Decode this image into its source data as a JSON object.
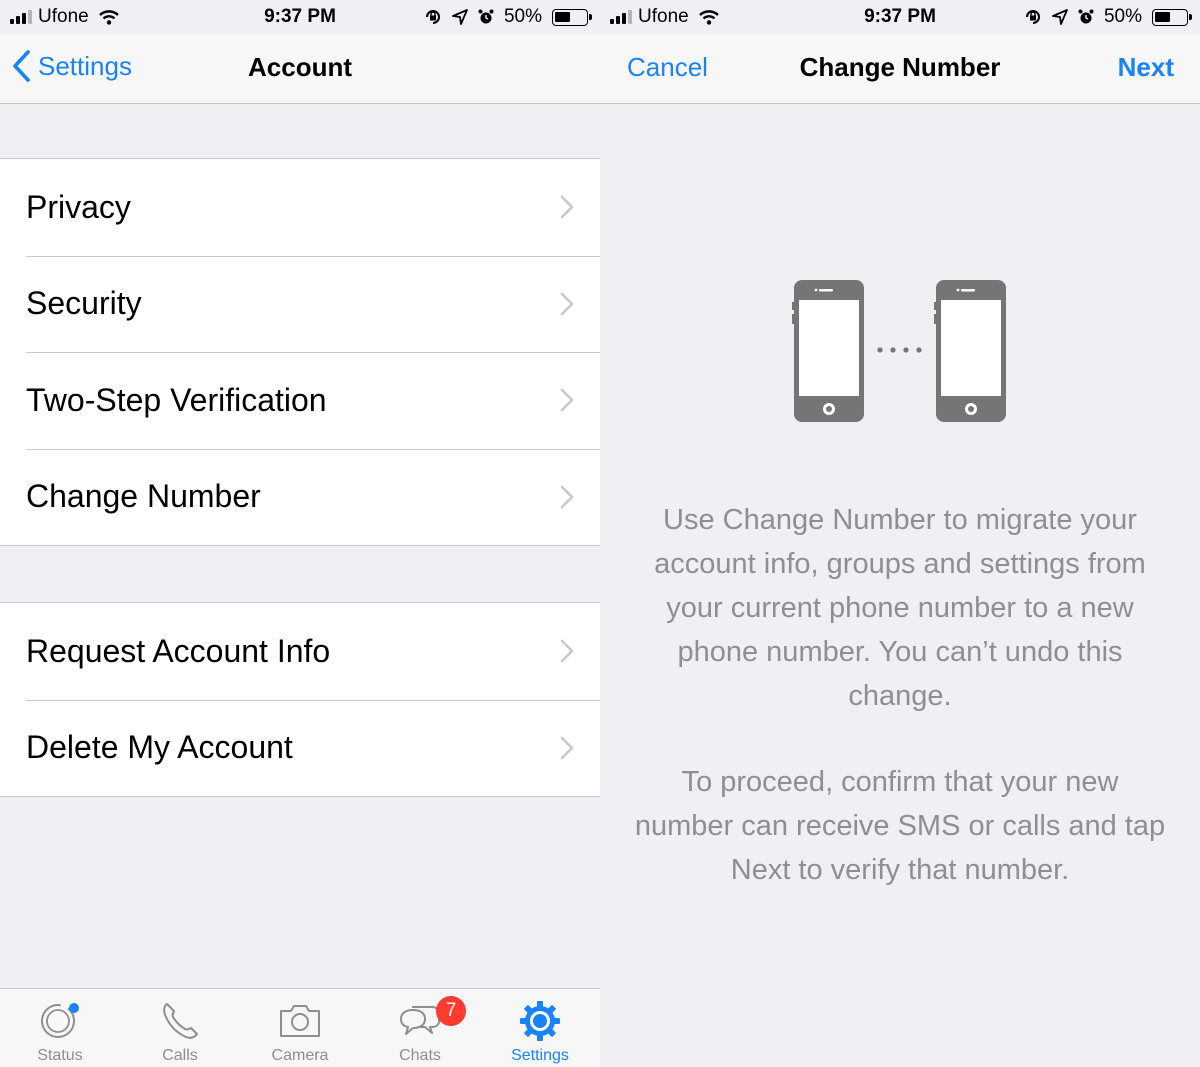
{
  "status_bar": {
    "carrier": "Ufone",
    "time": "9:37 PM",
    "battery": "50%",
    "battery_level": 0.5,
    "icons": [
      "signal-icon",
      "wifi-icon",
      "orientation-lock-icon",
      "location-icon",
      "alarm-icon",
      "battery-icon"
    ]
  },
  "account_screen": {
    "nav": {
      "back_label": "Settings",
      "title": "Account"
    },
    "groups": [
      {
        "items": [
          {
            "label": "Privacy"
          },
          {
            "label": "Security"
          },
          {
            "label": "Two-Step Verification"
          },
          {
            "label": "Change Number"
          }
        ]
      },
      {
        "items": [
          {
            "label": "Request Account Info"
          },
          {
            "label": "Delete My Account"
          }
        ]
      }
    ],
    "tab_bar": {
      "tabs": [
        {
          "label": "Status",
          "icon": "status-icon",
          "has_dot": true
        },
        {
          "label": "Calls",
          "icon": "phone-icon"
        },
        {
          "label": "Camera",
          "icon": "camera-icon"
        },
        {
          "label": "Chats",
          "icon": "chat-bubbles-icon",
          "badge": "7"
        },
        {
          "label": "Settings",
          "icon": "gear-icon",
          "active": true
        }
      ]
    }
  },
  "change_number_screen": {
    "nav": {
      "cancel_label": "Cancel",
      "title": "Change Number",
      "next_label": "Next"
    },
    "illustration": "two-phones-icon",
    "paragraph_1": "Use Change Number to migrate your account info, groups and settings from your current phone number to a new phone number. You can’t undo this change.",
    "paragraph_2": "To proceed, confirm that your new number can receive SMS or calls and tap Next to verify that number."
  },
  "colors": {
    "accent": "#1a82fb",
    "background": "#efeff4",
    "badge": "#ff3b30",
    "secondary_text": "#8e8e93",
    "illustration": "#757575"
  }
}
